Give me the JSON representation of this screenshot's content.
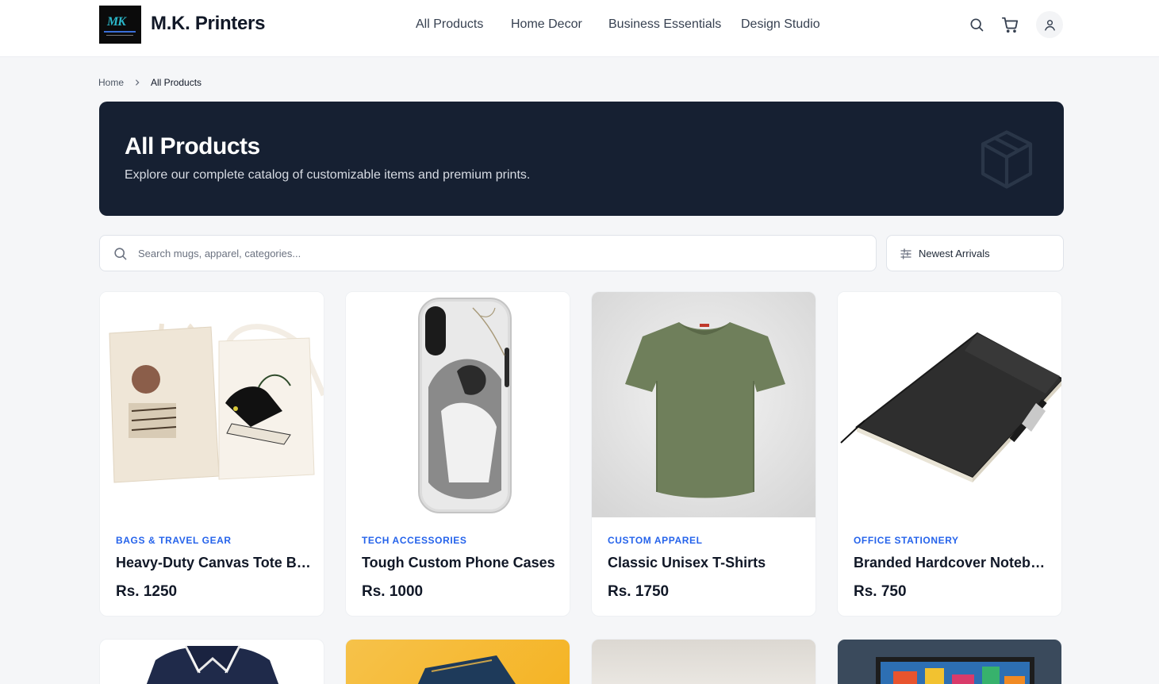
{
  "header": {
    "brand": "M.K. Printers",
    "logo_text": "MK",
    "nav": [
      "All Products",
      "Home Decor",
      "Business Essentials",
      "Design Studio"
    ]
  },
  "breadcrumb": {
    "home": "Home",
    "current": "All Products"
  },
  "hero": {
    "title": "All Products",
    "subtitle": "Explore our complete catalog of customizable items and premium prints."
  },
  "search": {
    "placeholder": "Search mugs, apparel, categories...",
    "value": ""
  },
  "sort": {
    "label": "Newest Arrivals"
  },
  "products": [
    {
      "category": "Bags & Travel Gear",
      "name": "Heavy-Duty Canvas Tote Bags",
      "price": "Rs. 1250"
    },
    {
      "category": "Tech Accessories",
      "name": "Tough Custom Phone Cases",
      "price": "Rs. 1000"
    },
    {
      "category": "Custom Apparel",
      "name": "Classic Unisex T-Shirts",
      "price": "Rs. 1750"
    },
    {
      "category": "Office Stationery",
      "name": "Branded Hardcover Notebooks",
      "price": "Rs. 750"
    }
  ],
  "colors": {
    "accent": "#2563eb",
    "hero_bg": "#162032",
    "page_bg": "#f5f6f8"
  }
}
